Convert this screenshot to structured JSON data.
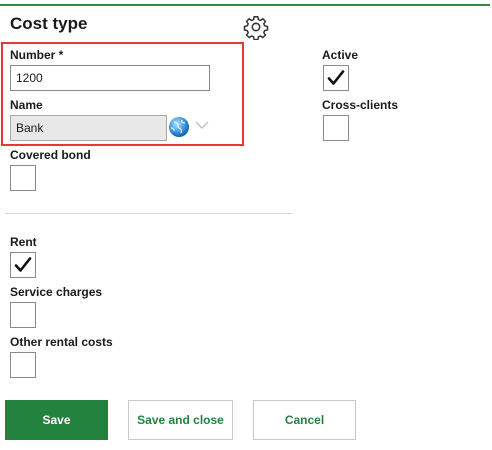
{
  "form": {
    "title": "Cost type"
  },
  "fields": {
    "number": {
      "label": "Number *",
      "value": "1200"
    },
    "name": {
      "label": "Name",
      "value": "Bank"
    },
    "active": {
      "label": "Active",
      "checked": true
    },
    "cross_clients": {
      "label": "Cross-clients",
      "checked": false
    },
    "covered_bond": {
      "label": "Covered bond",
      "checked": false
    },
    "rent": {
      "label": "Rent",
      "checked": true
    },
    "service_charges": {
      "label": "Service charges",
      "checked": false
    },
    "other_rental_costs": {
      "label": "Other rental costs",
      "checked": false
    }
  },
  "buttons": {
    "save": "Save",
    "save_and_close": "Save and close",
    "cancel": "Cancel"
  },
  "icons": {
    "settings": "gear-icon",
    "translation": "globe-icon",
    "dropdown": "chevron-down-icon",
    "check": "checkmark-icon"
  },
  "colors": {
    "accent": "#24823f",
    "highlight": "#e53935",
    "top_border": "#2e8b4a"
  }
}
